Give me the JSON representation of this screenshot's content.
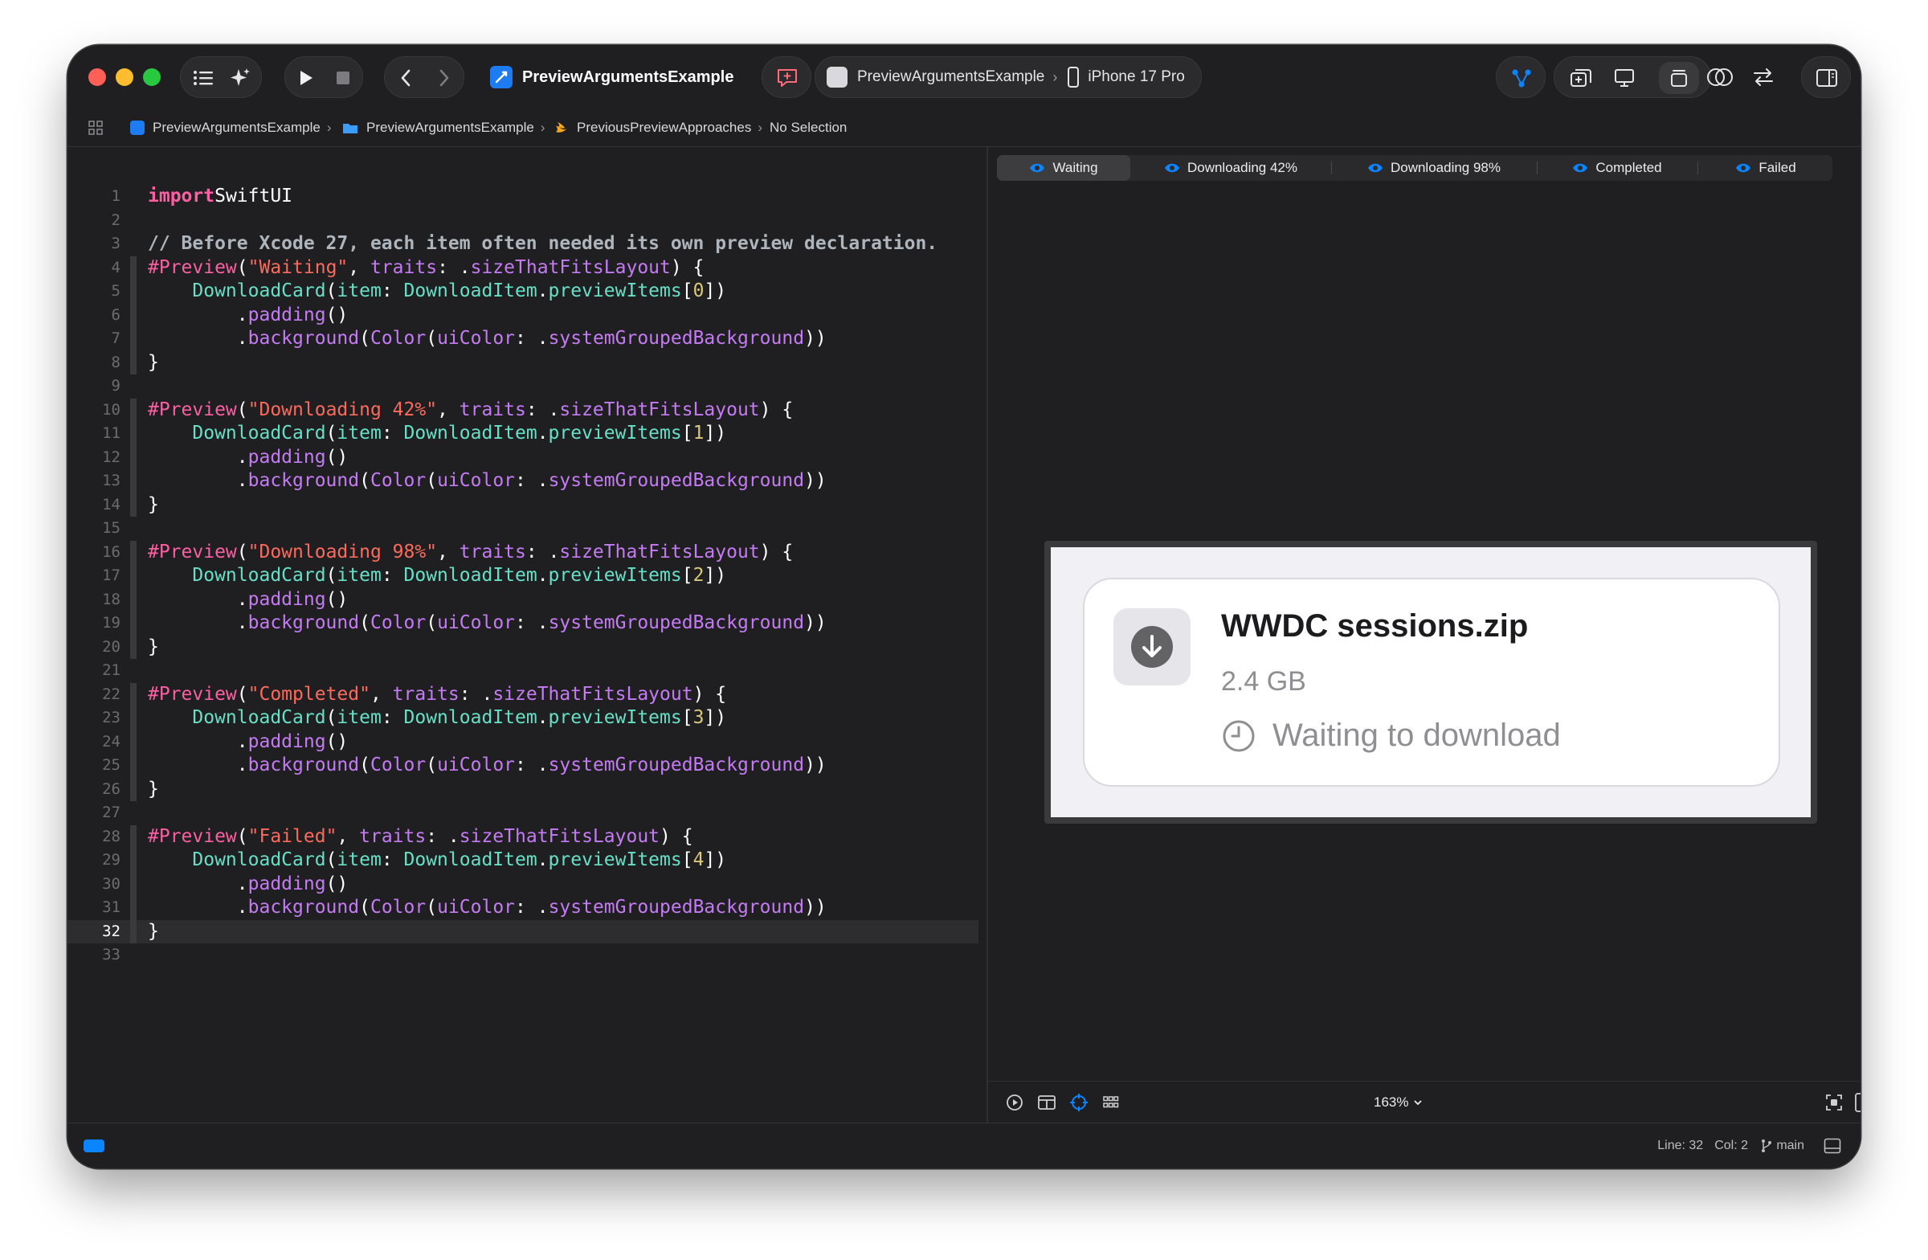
{
  "toolbar": {
    "project_name": "PreviewArgumentsExample",
    "scheme": "PreviewArgumentsExample",
    "device": "iPhone 17 Pro"
  },
  "jump_bar": {
    "items": [
      "PreviewArgumentsExample",
      "PreviewArgumentsExample",
      "PreviousPreviewApproaches",
      "No Selection"
    ]
  },
  "editor": {
    "current_line": 32,
    "lines": [
      {
        "n": "1",
        "t": [
          [
            "kw",
            "import"
          ],
          [
            "",
            "SwiftUI"
          ]
        ]
      },
      {
        "n": "2",
        "t": []
      },
      {
        "n": "3",
        "t": [
          [
            "cm",
            "// Before Xcode 27, each item often needed its own preview declaration."
          ]
        ]
      },
      {
        "n": "4",
        "t": [
          [
            "mac",
            "#Preview"
          ],
          [
            "",
            "("
          ],
          [
            "st",
            "\"Waiting\""
          ],
          [
            "",
            ", "
          ],
          [
            "mem",
            "traits"
          ],
          [
            "",
            ": ."
          ],
          [
            "mem",
            "sizeThatFitsLayout"
          ],
          [
            "",
            ") {"
          ]
        ]
      },
      {
        "n": "5",
        "t": [
          [
            "",
            "    "
          ],
          [
            "fn",
            "DownloadCard"
          ],
          [
            "",
            "("
          ],
          [
            "fn",
            "item"
          ],
          [
            "",
            ": "
          ],
          [
            "fn",
            "DownloadItem"
          ],
          [
            "",
            "."
          ],
          [
            "fn",
            "previewItems"
          ],
          [
            "",
            "["
          ],
          [
            "num",
            "0"
          ],
          [
            "",
            "])"
          ]
        ]
      },
      {
        "n": "6",
        "t": [
          [
            "",
            "        ."
          ],
          [
            "mem",
            "padding"
          ],
          [
            "",
            "()"
          ]
        ]
      },
      {
        "n": "7",
        "t": [
          [
            "",
            "        ."
          ],
          [
            "mem",
            "background"
          ],
          [
            "",
            "("
          ],
          [
            "mem",
            "Color"
          ],
          [
            "",
            "("
          ],
          [
            "mem",
            "uiColor"
          ],
          [
            "",
            ": ."
          ],
          [
            "mem",
            "systemGroupedBackground"
          ],
          [
            "",
            "))"
          ]
        ]
      },
      {
        "n": "8",
        "t": [
          [
            "",
            "}"
          ]
        ]
      },
      {
        "n": "9",
        "t": []
      },
      {
        "n": "10",
        "t": [
          [
            "mac",
            "#Preview"
          ],
          [
            "",
            "("
          ],
          [
            "st",
            "\"Downloading 42%\""
          ],
          [
            "",
            ", "
          ],
          [
            "mem",
            "traits"
          ],
          [
            "",
            ": ."
          ],
          [
            "mem",
            "sizeThatFitsLayout"
          ],
          [
            "",
            ") {"
          ]
        ]
      },
      {
        "n": "11",
        "t": [
          [
            "",
            "    "
          ],
          [
            "fn",
            "DownloadCard"
          ],
          [
            "",
            "("
          ],
          [
            "fn",
            "item"
          ],
          [
            "",
            ": "
          ],
          [
            "fn",
            "DownloadItem"
          ],
          [
            "",
            "."
          ],
          [
            "fn",
            "previewItems"
          ],
          [
            "",
            "["
          ],
          [
            "num",
            "1"
          ],
          [
            "",
            "])"
          ]
        ]
      },
      {
        "n": "12",
        "t": [
          [
            "",
            "        ."
          ],
          [
            "mem",
            "padding"
          ],
          [
            "",
            "()"
          ]
        ]
      },
      {
        "n": "13",
        "t": [
          [
            "",
            "        ."
          ],
          [
            "mem",
            "background"
          ],
          [
            "",
            "("
          ],
          [
            "mem",
            "Color"
          ],
          [
            "",
            "("
          ],
          [
            "mem",
            "uiColor"
          ],
          [
            "",
            ": ."
          ],
          [
            "mem",
            "systemGroupedBackground"
          ],
          [
            "",
            "))"
          ]
        ]
      },
      {
        "n": "14",
        "t": [
          [
            "",
            "}"
          ]
        ]
      },
      {
        "n": "15",
        "t": []
      },
      {
        "n": "16",
        "t": [
          [
            "mac",
            "#Preview"
          ],
          [
            "",
            "("
          ],
          [
            "st",
            "\"Downloading 98%\""
          ],
          [
            "",
            ", "
          ],
          [
            "mem",
            "traits"
          ],
          [
            "",
            ": ."
          ],
          [
            "mem",
            "sizeThatFitsLayout"
          ],
          [
            "",
            ") {"
          ]
        ]
      },
      {
        "n": "17",
        "t": [
          [
            "",
            "    "
          ],
          [
            "fn",
            "DownloadCard"
          ],
          [
            "",
            "("
          ],
          [
            "fn",
            "item"
          ],
          [
            "",
            ": "
          ],
          [
            "fn",
            "DownloadItem"
          ],
          [
            "",
            "."
          ],
          [
            "fn",
            "previewItems"
          ],
          [
            "",
            "["
          ],
          [
            "num",
            "2"
          ],
          [
            "",
            "])"
          ]
        ]
      },
      {
        "n": "18",
        "t": [
          [
            "",
            "        ."
          ],
          [
            "mem",
            "padding"
          ],
          [
            "",
            "()"
          ]
        ]
      },
      {
        "n": "19",
        "t": [
          [
            "",
            "        ."
          ],
          [
            "mem",
            "background"
          ],
          [
            "",
            "("
          ],
          [
            "mem",
            "Color"
          ],
          [
            "",
            "("
          ],
          [
            "mem",
            "uiColor"
          ],
          [
            "",
            ": ."
          ],
          [
            "mem",
            "systemGroupedBackground"
          ],
          [
            "",
            "))"
          ]
        ]
      },
      {
        "n": "20",
        "t": [
          [
            "",
            "}"
          ]
        ]
      },
      {
        "n": "21",
        "t": []
      },
      {
        "n": "22",
        "t": [
          [
            "mac",
            "#Preview"
          ],
          [
            "",
            "("
          ],
          [
            "st",
            "\"Completed\""
          ],
          [
            "",
            ", "
          ],
          [
            "mem",
            "traits"
          ],
          [
            "",
            ": ."
          ],
          [
            "mem",
            "sizeThatFitsLayout"
          ],
          [
            "",
            ") {"
          ]
        ]
      },
      {
        "n": "23",
        "t": [
          [
            "",
            "    "
          ],
          [
            "fn",
            "DownloadCard"
          ],
          [
            "",
            "("
          ],
          [
            "fn",
            "item"
          ],
          [
            "",
            ": "
          ],
          [
            "fn",
            "DownloadItem"
          ],
          [
            "",
            "."
          ],
          [
            "fn",
            "previewItems"
          ],
          [
            "",
            "["
          ],
          [
            "num",
            "3"
          ],
          [
            "",
            "])"
          ]
        ]
      },
      {
        "n": "24",
        "t": [
          [
            "",
            "        ."
          ],
          [
            "mem",
            "padding"
          ],
          [
            "",
            "()"
          ]
        ]
      },
      {
        "n": "25",
        "t": [
          [
            "",
            "        ."
          ],
          [
            "mem",
            "background"
          ],
          [
            "",
            "("
          ],
          [
            "mem",
            "Color"
          ],
          [
            "",
            "("
          ],
          [
            "mem",
            "uiColor"
          ],
          [
            "",
            ": ."
          ],
          [
            "mem",
            "systemGroupedBackground"
          ],
          [
            "",
            "))"
          ]
        ]
      },
      {
        "n": "26",
        "t": [
          [
            "",
            "}"
          ]
        ]
      },
      {
        "n": "27",
        "t": []
      },
      {
        "n": "28",
        "t": [
          [
            "mac",
            "#Preview"
          ],
          [
            "",
            "("
          ],
          [
            "st",
            "\"Failed\""
          ],
          [
            "",
            ", "
          ],
          [
            "mem",
            "traits"
          ],
          [
            "",
            ": ."
          ],
          [
            "mem",
            "sizeThatFitsLayout"
          ],
          [
            "",
            ") {"
          ]
        ]
      },
      {
        "n": "29",
        "t": [
          [
            "",
            "    "
          ],
          [
            "fn",
            "DownloadCard"
          ],
          [
            "",
            "("
          ],
          [
            "fn",
            "item"
          ],
          [
            "",
            ": "
          ],
          [
            "fn",
            "DownloadItem"
          ],
          [
            "",
            "."
          ],
          [
            "fn",
            "previewItems"
          ],
          [
            "",
            "["
          ],
          [
            "num",
            "4"
          ],
          [
            "",
            "])"
          ]
        ]
      },
      {
        "n": "30",
        "t": [
          [
            "",
            "        ."
          ],
          [
            "mem",
            "padding"
          ],
          [
            "",
            "()"
          ]
        ]
      },
      {
        "n": "31",
        "t": [
          [
            "",
            "        ."
          ],
          [
            "mem",
            "background"
          ],
          [
            "",
            "("
          ],
          [
            "mem",
            "Color"
          ],
          [
            "",
            "("
          ],
          [
            "mem",
            "uiColor"
          ],
          [
            "",
            ": ."
          ],
          [
            "mem",
            "systemGroupedBackground"
          ],
          [
            "",
            "))"
          ]
        ]
      },
      {
        "n": "32",
        "t": [
          [
            "",
            "}"
          ]
        ]
      },
      {
        "n": "33",
        "t": []
      }
    ]
  },
  "preview": {
    "tabs": [
      "Waiting",
      "Downloading 42%",
      "Downloading 98%",
      "Completed",
      "Failed"
    ],
    "selected_tab": "Waiting",
    "card": {
      "title": "WWDC sessions.zip",
      "size": "2.4 GB",
      "status": "Waiting to download"
    },
    "zoom": "163%"
  },
  "status_bar": {
    "line": "Line: 32",
    "col": "Col: 2",
    "branch": "main"
  },
  "colors": {
    "accent": "#0a84ff",
    "close": "#ff5f57",
    "minimize": "#febc2e",
    "zoom": "#28c840"
  }
}
